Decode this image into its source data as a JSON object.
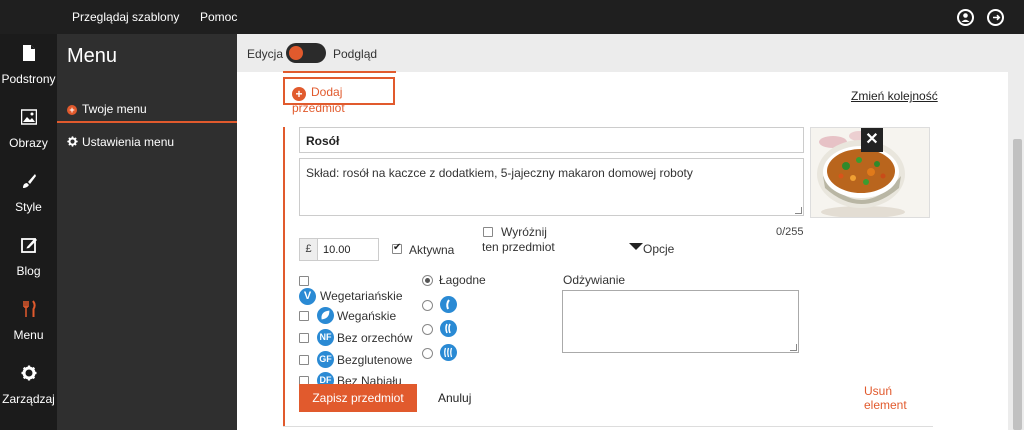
{
  "topbar": {
    "browse_templates": "Przeglądaj szablony",
    "help": "Pomoc",
    "icons": [
      "user-circle-icon",
      "logout-icon"
    ]
  },
  "rail": {
    "items": [
      {
        "label": "Podstrony",
        "icon": "page-icon"
      },
      {
        "label": "Obrazy",
        "icon": "image-icon"
      },
      {
        "label": "Style",
        "icon": "brush-icon"
      },
      {
        "label": "Blog",
        "icon": "edit-icon"
      },
      {
        "label": "Menu",
        "icon": "fork-knife-icon",
        "active": true
      },
      {
        "label": "Zarządzaj",
        "icon": "gear-icon"
      }
    ]
  },
  "menu_panel": {
    "title": "Menu",
    "entries": [
      {
        "label": "Twoje menu",
        "icon": "plus-dot-icon",
        "active": true
      },
      {
        "label": "Ustawienia menu",
        "icon": "gear-icon"
      }
    ]
  },
  "mode": {
    "edit_label": "Edycja",
    "preview_label": "Podgląd"
  },
  "actions": {
    "add_item": "Dodaj przedmiot",
    "reorder": "Zmień kolejność"
  },
  "item": {
    "name": "Rosół",
    "description": "Skład: rosół na kaczce z dodatkiem, 5-jajeczny makaron domowej roboty",
    "counter": "0/255",
    "currency": "£",
    "price": "10.00",
    "active_label": "Aktywna",
    "active_checked": true,
    "highlight_label_1": "Wyróżnij",
    "highlight_label_2": "ten przedmiot",
    "options_label": "Opcje",
    "diet": [
      {
        "badge": "V",
        "label": "Wegetariańskie"
      },
      {
        "badge": "leaf",
        "label": "Wegańskie"
      },
      {
        "badge": "NF",
        "label": "Bez orzechów"
      },
      {
        "badge": "GF",
        "label": "Bezglutenowe"
      },
      {
        "badge": "DF",
        "label": "Bez Nabiału"
      }
    ],
    "spice": [
      {
        "label": "Łagodne",
        "checked": true
      },
      {
        "badge": "chili-1-icon"
      },
      {
        "badge": "chili-2-icon"
      },
      {
        "badge": "chili-3-icon"
      }
    ],
    "nutrition_label": "Odżywianie",
    "save": "Zapisz przedmiot",
    "cancel": "Anuluj",
    "delete": "Usuń element",
    "close": "✕"
  },
  "colors": {
    "accent": "#e15a2d",
    "badge_blue": "#2a8ad4",
    "topbar": "#1f1f1f",
    "rail": "#1b1b1b",
    "menu_panel": "#2f2f2f"
  }
}
